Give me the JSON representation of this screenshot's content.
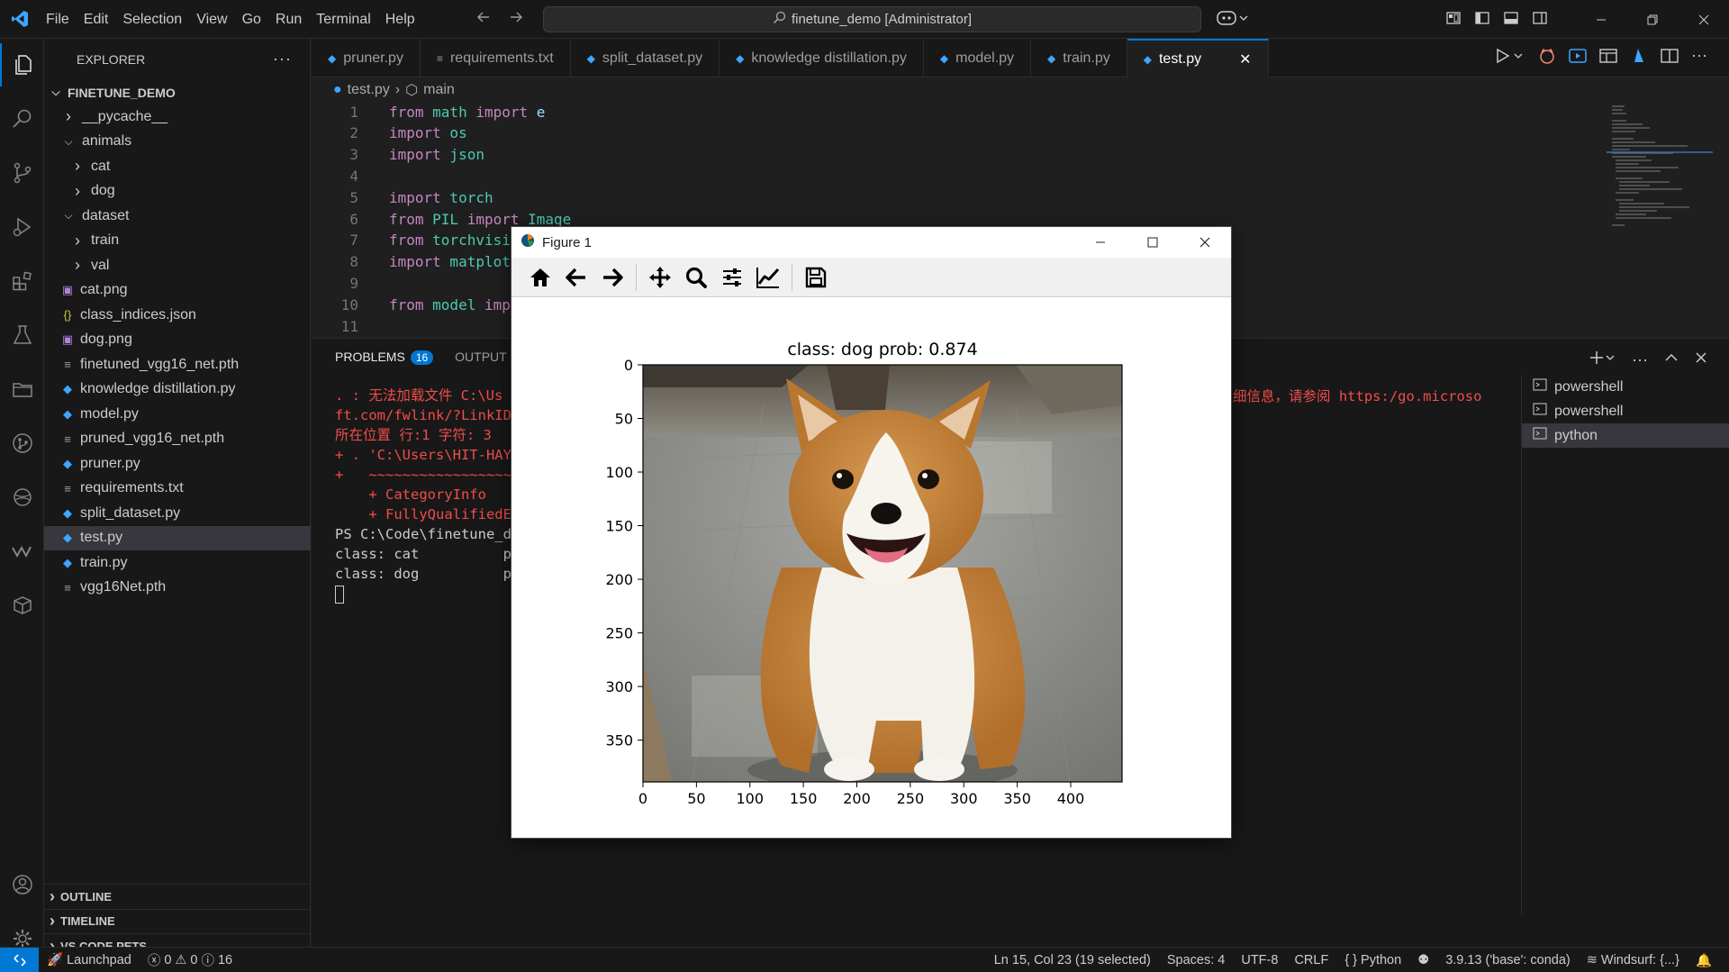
{
  "menu": [
    "File",
    "Edit",
    "Selection",
    "View",
    "Go",
    "Run",
    "Terminal",
    "Help"
  ],
  "command_center": "finetune_demo [Administrator]",
  "explorer": {
    "title": "EXPLORER",
    "root": "FINETUNE_DEMO",
    "items": [
      {
        "label": "__pycache__",
        "type": "folder",
        "open": false,
        "indent": 1
      },
      {
        "label": "animals",
        "type": "folder",
        "open": true,
        "indent": 1
      },
      {
        "label": "cat",
        "type": "folder",
        "open": false,
        "indent": 2
      },
      {
        "label": "dog",
        "type": "folder",
        "open": false,
        "indent": 2
      },
      {
        "label": "dataset",
        "type": "folder",
        "open": true,
        "indent": 1
      },
      {
        "label": "train",
        "type": "folder",
        "open": false,
        "indent": 2
      },
      {
        "label": "val",
        "type": "folder",
        "open": false,
        "indent": 2
      },
      {
        "label": "cat.png",
        "type": "image",
        "indent": 1
      },
      {
        "label": "class_indices.json",
        "type": "json",
        "indent": 1
      },
      {
        "label": "dog.png",
        "type": "image",
        "indent": 1
      },
      {
        "label": "finetuned_vgg16_net.pth",
        "type": "text",
        "indent": 1
      },
      {
        "label": "knowledge distillation.py",
        "type": "python",
        "indent": 1
      },
      {
        "label": "model.py",
        "type": "python",
        "indent": 1
      },
      {
        "label": "pruned_vgg16_net.pth",
        "type": "text",
        "indent": 1
      },
      {
        "label": "pruner.py",
        "type": "python",
        "indent": 1
      },
      {
        "label": "requirements.txt",
        "type": "text",
        "indent": 1
      },
      {
        "label": "split_dataset.py",
        "type": "python",
        "indent": 1
      },
      {
        "label": "test.py",
        "type": "python",
        "indent": 1,
        "selected": true
      },
      {
        "label": "train.py",
        "type": "python",
        "indent": 1
      },
      {
        "label": "vgg16Net.pth",
        "type": "text",
        "indent": 1
      }
    ],
    "sections": [
      "OUTLINE",
      "TIMELINE",
      "VS CODE PETS"
    ]
  },
  "tabs": [
    {
      "label": "pruner.py",
      "icon": "python"
    },
    {
      "label": "requirements.txt",
      "icon": "text"
    },
    {
      "label": "split_dataset.py",
      "icon": "python"
    },
    {
      "label": "knowledge distillation.py",
      "icon": "python"
    },
    {
      "label": "model.py",
      "icon": "python"
    },
    {
      "label": "train.py",
      "icon": "python"
    },
    {
      "label": "test.py",
      "icon": "python",
      "active": true
    }
  ],
  "breadcrumb": {
    "file": "test.py",
    "symbol": "main"
  },
  "code_lines": [
    {
      "n": "1",
      "tokens": [
        [
          "kw",
          "from"
        ],
        [
          "mod",
          " math"
        ],
        [
          "kw",
          " import"
        ],
        [
          "id",
          " e"
        ]
      ]
    },
    {
      "n": "2",
      "tokens": [
        [
          "kw",
          "import"
        ],
        [
          "mod",
          " os"
        ]
      ]
    },
    {
      "n": "3",
      "tokens": [
        [
          "kw",
          "import"
        ],
        [
          "mod",
          " json"
        ]
      ]
    },
    {
      "n": "4",
      "tokens": []
    },
    {
      "n": "5",
      "tokens": [
        [
          "kw",
          "import"
        ],
        [
          "mod",
          " torch"
        ]
      ]
    },
    {
      "n": "6",
      "tokens": [
        [
          "kw",
          "from"
        ],
        [
          "mod",
          " PIL"
        ],
        [
          "kw",
          " import"
        ],
        [
          "mod",
          " Image"
        ]
      ]
    },
    {
      "n": "7",
      "tokens": [
        [
          "kw",
          "from"
        ],
        [
          "mod",
          " torchvisi"
        ]
      ]
    },
    {
      "n": "8",
      "tokens": [
        [
          "kw",
          "import"
        ],
        [
          "mod",
          " matplot"
        ]
      ]
    },
    {
      "n": "9",
      "tokens": []
    },
    {
      "n": "10",
      "tokens": [
        [
          "kw",
          "from"
        ],
        [
          "mod",
          " model"
        ],
        [
          "kw",
          " imp"
        ]
      ]
    },
    {
      "n": "11",
      "tokens": []
    }
  ],
  "panel": {
    "tabs": [
      {
        "label": "PROBLEMS",
        "badge": "16"
      },
      {
        "label": "OUTPUT"
      }
    ],
    "terminal_lines": [
      {
        "cls": "err",
        "text": ". : 无法加载文件 C:\\Us"
      },
      {
        "cls": "err",
        "text": "ft.com/fwlink/?LinkID="
      },
      {
        "cls": "err",
        "text": "所在位置 行:1 字符: 3"
      },
      {
        "cls": "err",
        "text": "+ . 'C:\\Users\\HIT-HAYE"
      },
      {
        "cls": "err",
        "text": "+   ~~~~~~~~~~~~~~~~~~"
      },
      {
        "cls": "err",
        "text": "    + CategoryInfo"
      },
      {
        "cls": "err",
        "text": "    + FullyQualifiedEr"
      },
      {
        "cls": "",
        "text": "PS C:\\Code\\finetune_de"
      },
      {
        "cls": "",
        "text": "class: cat          pr"
      },
      {
        "cls": "",
        "text": "class: dog          pr"
      }
    ],
    "terminal_right": "细信息，请参阅 https:/go.microso",
    "terminals": [
      {
        "label": "powershell"
      },
      {
        "label": "powershell"
      },
      {
        "label": "python",
        "active": true
      }
    ]
  },
  "statusbar": {
    "launchpad": "Launchpad",
    "errors": "0",
    "warnings": "0",
    "infos": "16",
    "position": "Ln 15, Col 23 (19 selected)",
    "spaces": "Spaces: 4",
    "encoding": "UTF-8",
    "eol": "CRLF",
    "language": "Python",
    "interpreter": "3.9.13 ('base': conda)",
    "windsurf": "Windsurf: {...}"
  },
  "figure": {
    "window_title": "Figure 1",
    "toolbar": [
      "home-icon",
      "back-icon",
      "forward-icon",
      "pan-icon",
      "zoom-icon",
      "configure-subplots-icon",
      "edit-axes-icon",
      "save-icon"
    ]
  },
  "chart_data": {
    "type": "image",
    "title": "class: dog   prob: 0.874",
    "xlabel": "",
    "ylabel": "",
    "xlim": [
      0,
      448
    ],
    "ylim": [
      389,
      0
    ],
    "xticks": [
      0,
      50,
      100,
      150,
      200,
      250,
      300,
      350,
      400
    ],
    "yticks": [
      0,
      50,
      100,
      150,
      200,
      250,
      300,
      350
    ],
    "grid": false,
    "image_content": "corgi-dog-photo"
  }
}
